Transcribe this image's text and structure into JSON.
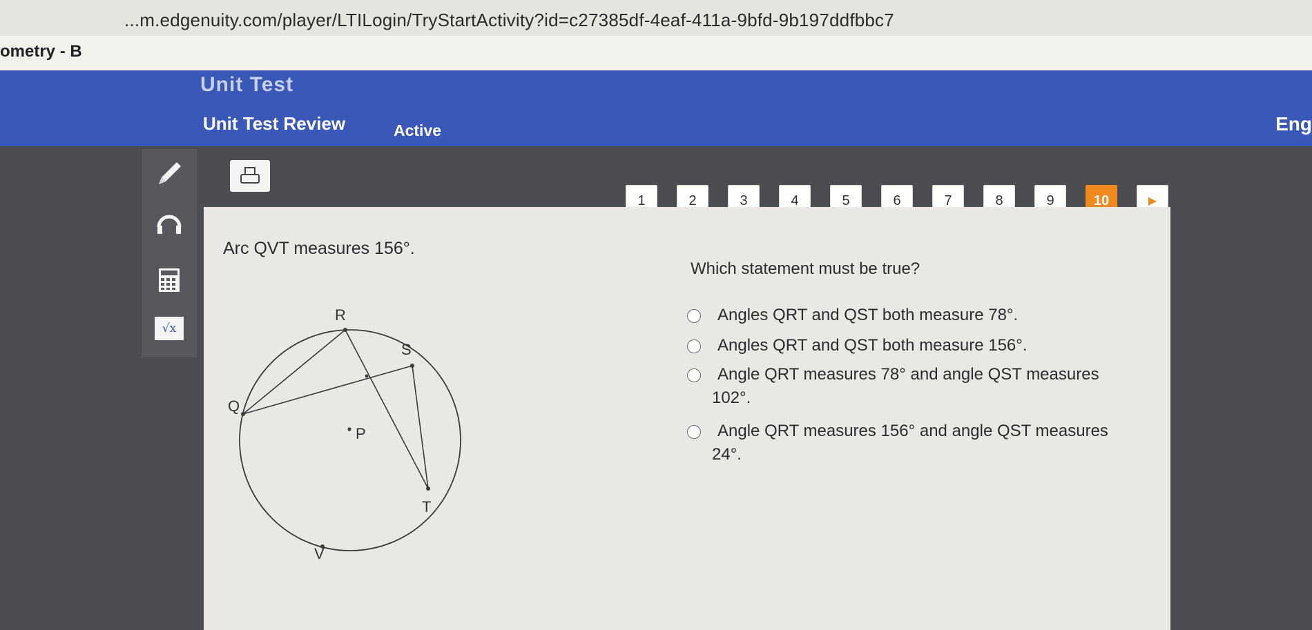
{
  "browser": {
    "url": "...m.edgenuity.com/player/LTILogin/TryStartActivity?id=c27385df-4eaf-411a-9bfd-9b197ddfbbc7"
  },
  "course": {
    "title": "ometry - B"
  },
  "header": {
    "unit_title": "Unit Test",
    "activity_title": "Unit Test Review",
    "status": "Active",
    "language": "Eng"
  },
  "colors": {
    "header_blue": "#3a58b8",
    "accent_orange": "#f08a1f",
    "background_dark": "#4b4d51",
    "panel": "#e9e8e4"
  },
  "tools": {
    "items": [
      "pencil-icon",
      "headphones-icon",
      "calculator-icon",
      "sqrt-icon"
    ],
    "sqrt_label": "√x"
  },
  "print": {
    "icon": "printer-icon"
  },
  "question_nav": {
    "items": [
      "1",
      "2",
      "3",
      "4",
      "5",
      "6",
      "7",
      "8",
      "9",
      "10"
    ],
    "current": "10",
    "next_icon": "▶"
  },
  "question": {
    "prompt": "Arc QVT measures 156°.",
    "stem": "Which statement must be true?",
    "options": [
      "Angles QRT and QST both measure 78°.",
      "Angles QRT and QST both measure 156°.",
      "Angle QRT measures 78° and angle QST measures 102°.",
      "Angle QRT measures 156° and angle QST measures 24°."
    ]
  },
  "diagram": {
    "points": [
      "R",
      "S",
      "Q",
      "P",
      "T",
      "V"
    ]
  }
}
